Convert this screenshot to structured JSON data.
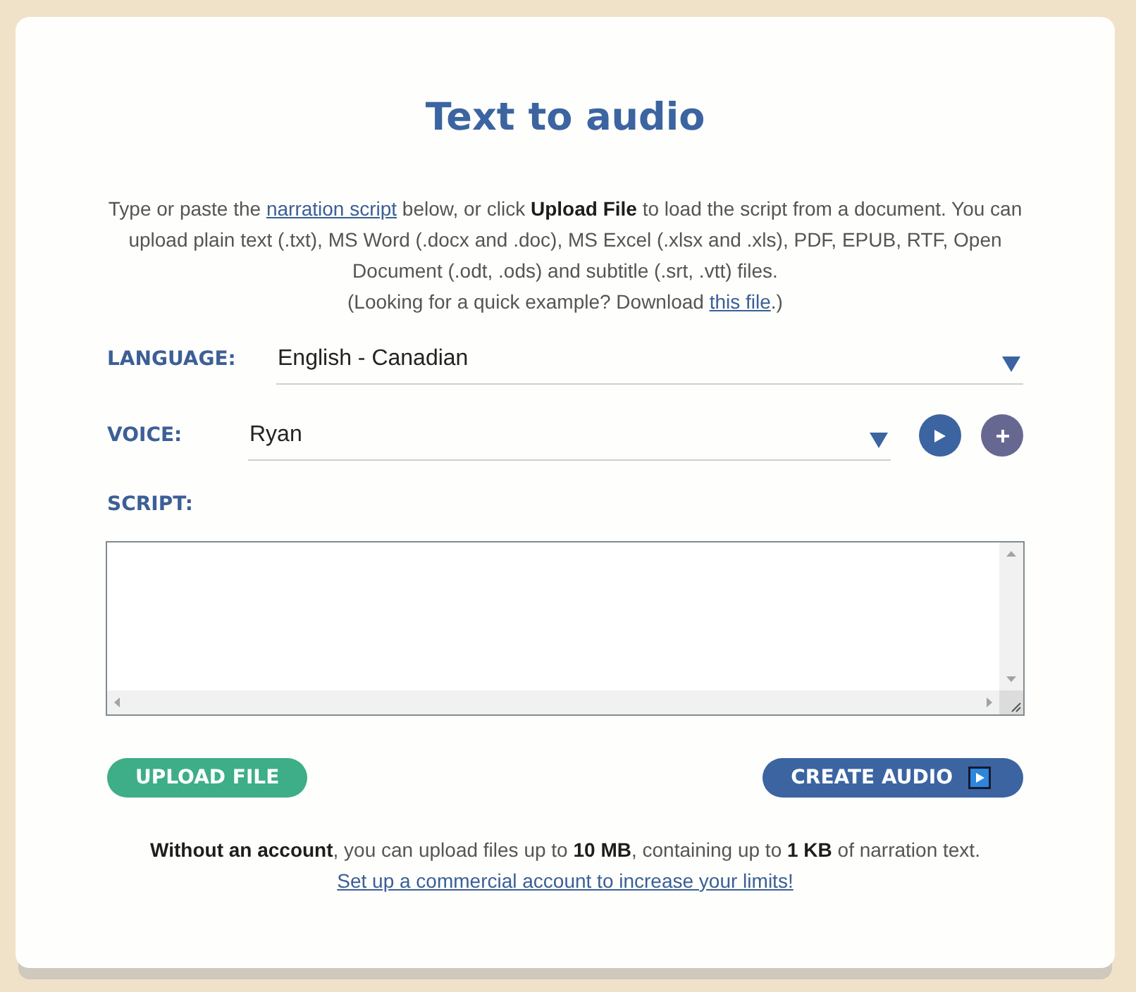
{
  "title": "Text to audio",
  "intro": [
    {
      "kind": "text",
      "text": "Type or paste the "
    },
    {
      "kind": "link",
      "text": "narration script"
    },
    {
      "kind": "text",
      "text": " below, or click **Upload File** to load the script from a document. You can upload plain text (.txt), MS Word (.docx and .doc), MS Excel (.xlsx and .xls), PDF, EPUB, RTF, Open Document (.odt, .ods) and subtitle (.srt, .vtt) files."
    }
  ],
  "example": [
    {
      "kind": "text",
      "text": "(Looking for a quick example? Download "
    },
    {
      "kind": "link",
      "text": "this file"
    },
    {
      "kind": "text",
      "text": ".)"
    }
  ],
  "language": {
    "label": "LANGUAGE:",
    "value": "English - Canadian"
  },
  "voice": {
    "label": "VOICE:",
    "value": "Ryan"
  },
  "script": {
    "label": "SCRIPT:"
  },
  "upload_button": {
    "label": "UPLOAD FILE"
  },
  "create_button": {
    "label": "CREATE AUDIO"
  },
  "footer": {
    "note": [
      {
        "kind": "text",
        "text": "**Without an account**, you can upload files up to **10 MB**, containing up to **1 KB** of narration text."
      }
    ],
    "link": "Set up a commercial account to increase your limits!"
  }
}
